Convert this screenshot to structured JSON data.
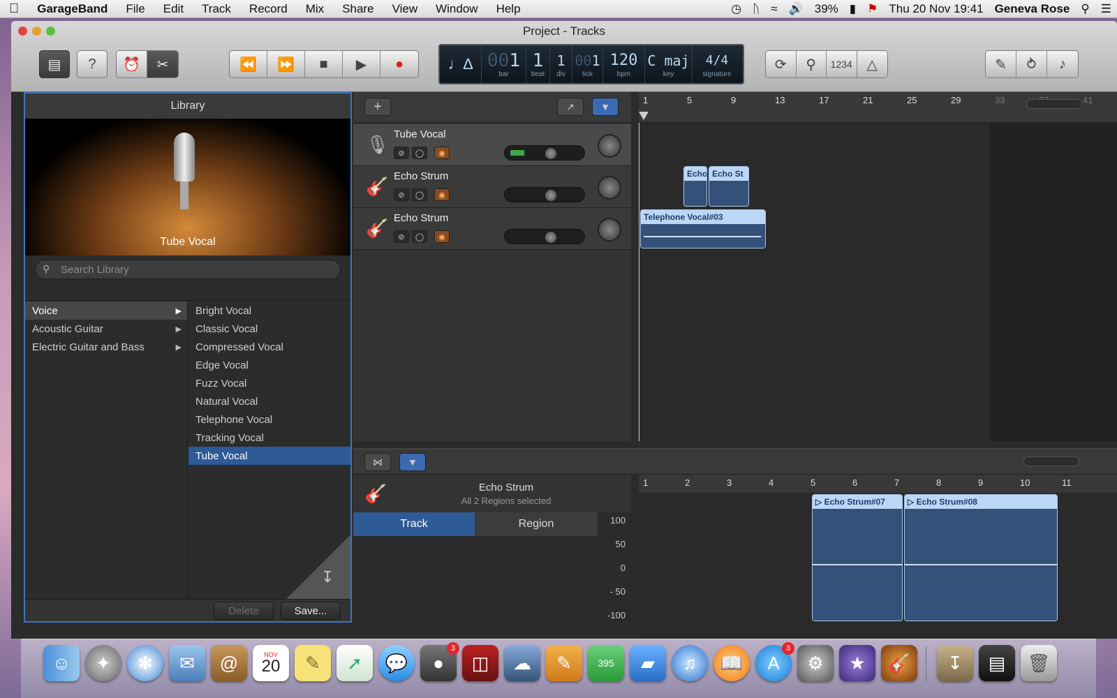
{
  "menubar": {
    "app": "GarageBand",
    "items": [
      "File",
      "Edit",
      "Track",
      "Record",
      "Mix",
      "Share",
      "View",
      "Window",
      "Help"
    ],
    "battery": "39%",
    "datetime": "Thu 20 Nov  19:41",
    "user": "Geneva Rose"
  },
  "window": {
    "title": "Project - Tracks"
  },
  "lcd": {
    "bar": "1",
    "bar_prefix": "00",
    "bar_label": "bar",
    "beat": "1",
    "beat_label": "beat",
    "div": "1",
    "div_label": "div",
    "tick": "1",
    "tick_prefix": "00",
    "tick_label": "tick",
    "bpm": "120",
    "bpm_label": "bpm",
    "key": "C maj",
    "key_label": "key",
    "signature": "4/4",
    "signature_label": "signature"
  },
  "toolbar": {
    "count_in_label": "1234"
  },
  "library": {
    "title": "Library",
    "hero_label": "Tube Vocal",
    "search_placeholder": "Search Library",
    "categories": [
      "Voice",
      "Acoustic Guitar",
      "Electric Guitar and Bass"
    ],
    "presets": [
      "Bright Vocal",
      "Classic Vocal",
      "Compressed Vocal",
      "Edge Vocal",
      "Fuzz Vocal",
      "Natural Vocal",
      "Telephone Vocal",
      "Tracking Vocal",
      "Tube Vocal"
    ],
    "selected_category": "Voice",
    "selected_preset": "Tube Vocal",
    "delete_label": "Delete",
    "save_label": "Save..."
  },
  "tracks": [
    {
      "name": "Tube Vocal",
      "volume": 0.6
    },
    {
      "name": "Echo Strum",
      "volume": 0.6
    },
    {
      "name": "Echo Strum",
      "volume": 0.6
    }
  ],
  "ruler": {
    "markers": [
      "1",
      "5",
      "9",
      "13",
      "17",
      "21",
      "25",
      "29",
      "33",
      "37",
      "41"
    ]
  },
  "regions": {
    "echo_a": "Echo",
    "echo_b": "Echo St",
    "telephone": "Telephone Vocal#03"
  },
  "editor": {
    "track_name": "Echo Strum",
    "selection": "All 2 Regions selected",
    "tab_track": "Track",
    "tab_region": "Region",
    "ruler": [
      "1",
      "2",
      "3",
      "4",
      "5",
      "6",
      "7",
      "8",
      "9",
      "10",
      "11"
    ],
    "y_ticks": [
      "100",
      "50",
      "0",
      "- 50",
      "-100"
    ],
    "region_a": "Echo Strum#07",
    "region_b": "Echo Strum#08"
  },
  "dock": {
    "facetime_badge": "3",
    "appstore_badge": "3",
    "calendar_month": "NOV",
    "calendar_day": "20",
    "numbers_label": "395"
  },
  "colors": {
    "accent": "#3b6ab0",
    "region_header": "#bcd7f5",
    "region_body": "#34517a",
    "record": "#e3262b"
  }
}
